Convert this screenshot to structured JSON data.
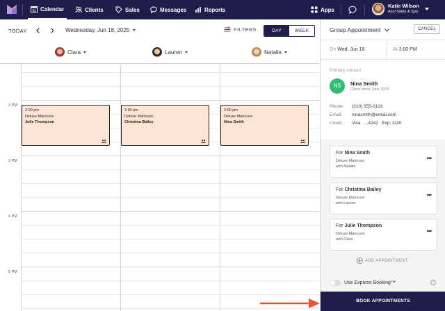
{
  "nav": {
    "items": [
      {
        "label": "Calendar",
        "icon": "calendar-icon"
      },
      {
        "label": "Clients",
        "icon": "clients-icon"
      },
      {
        "label": "Sales",
        "icon": "sales-icon"
      },
      {
        "label": "Messages",
        "icon": "messages-icon"
      },
      {
        "label": "Reports",
        "icon": "reports-icon"
      }
    ],
    "apps_label": "Apps",
    "user_name": "Katie Wilson",
    "user_business": "Azul Salon & Spa"
  },
  "toolbar": {
    "today_label": "TODAY",
    "date_label": "Wednesday, Jun 18, 2025",
    "filters_label": "FILTERS",
    "view_day": "DAY",
    "view_week": "WEEK",
    "active_view": "DAY"
  },
  "staff": [
    {
      "name": "Clara"
    },
    {
      "name": "Lauren"
    },
    {
      "name": "Natalie"
    }
  ],
  "time_labels": [
    "2 PM",
    "3 PM",
    "4 PM",
    "5 PM"
  ],
  "appointments": [
    {
      "time": "2:00 pm",
      "service": "Deluxe Manicure",
      "client": "Julie Thompson",
      "staff": "Clara"
    },
    {
      "time": "2:00 pm",
      "service": "Deluxe Manicure",
      "client": "Christina Bailey",
      "staff": "Lauren"
    },
    {
      "time": "2:00 pm",
      "service": "Deluxe Manicure",
      "client": "Nina Smith",
      "staff": "Natalie"
    }
  ],
  "panel": {
    "title": "Group Appointment",
    "cancel_label": "CANCEL",
    "on_label": "On",
    "on_value": "Wed, Jun 18",
    "at_label": "At",
    "at_value": "2:00 PM",
    "primary_contact_label": "Primary contact",
    "contact": {
      "initials": "NS",
      "name": "Nina Smith",
      "since": "Client since June 2025",
      "phone_label": "Phone:",
      "phone": "(310) 555-0123",
      "email_label": "Email:",
      "email": "ninasmith@email.com",
      "credit_label": "Credit:",
      "credit": "Visa   ...4242   Exp: 3/28"
    },
    "cards": [
      {
        "for_label": "For",
        "name": "Nina Smith",
        "service": "Deluxe Manicure",
        "with": "with Natalie"
      },
      {
        "for_label": "For",
        "name": "Christina Bailey",
        "service": "Deluxe Manicure",
        "with": "with Lauren"
      },
      {
        "for_label": "For",
        "name": "Julie Thompson",
        "service": "Deluxe Manicure",
        "with": "with Clara"
      }
    ],
    "add_appointment_label": "ADD APPOINTMENT",
    "express_label": "Use Express Booking™",
    "express_on": false,
    "book_label": "BOOK APPOINTMENTS"
  },
  "colors": {
    "navy": "#1f1d4a",
    "appointment_fill": "#fde5d5",
    "contact_badge": "#2ebd73",
    "arrow": "#e8543a"
  }
}
